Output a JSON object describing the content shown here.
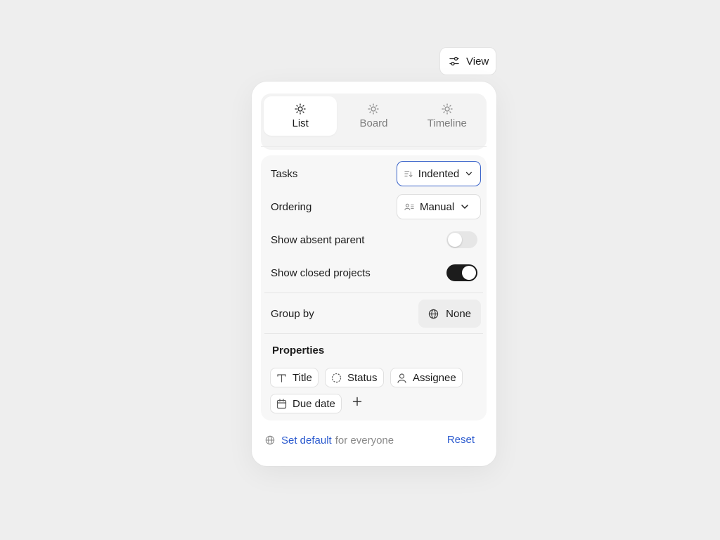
{
  "view_button": {
    "label": "View",
    "icon": "sliders-icon"
  },
  "tabs": [
    {
      "label": "List",
      "icon": "sun-icon",
      "active": true
    },
    {
      "label": "Board",
      "icon": "sun-icon",
      "active": false
    },
    {
      "label": "Timeline",
      "icon": "sun-icon",
      "active": false
    }
  ],
  "settings": {
    "tasks": {
      "label": "Tasks",
      "value": "Indented",
      "icon": "sort-icon"
    },
    "ordering": {
      "label": "Ordering",
      "value": "Manual",
      "icon": "user-list-icon"
    },
    "show_absent_parent": {
      "label": "Show absent parent",
      "enabled": false
    },
    "show_closed_projects": {
      "label": "Show closed projects",
      "enabled": true
    },
    "group_by": {
      "label": "Group by",
      "value": "None",
      "icon": "globe-icon"
    }
  },
  "properties": {
    "title": "Properties",
    "items": [
      {
        "label": "Title",
        "icon": "text-icon"
      },
      {
        "label": "Status",
        "icon": "dashed-circle-icon"
      },
      {
        "label": "Assignee",
        "icon": "user-icon"
      },
      {
        "label": "Due date",
        "icon": "calendar-icon"
      }
    ]
  },
  "footer": {
    "set_default": "Set default",
    "for_everyone": "for everyone",
    "reset": "Reset"
  },
  "colors": {
    "accent": "#2c5bcf",
    "toggle_on": "#1c1c1c",
    "focus_border": "#3a63c9"
  }
}
